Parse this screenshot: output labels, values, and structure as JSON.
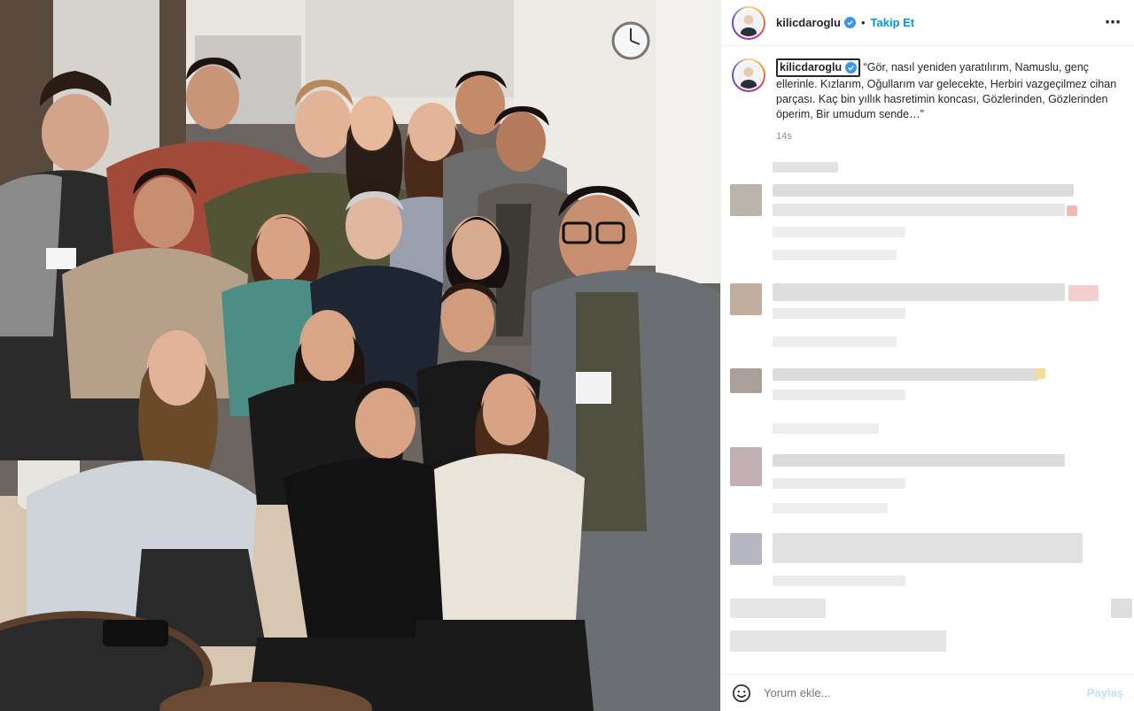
{
  "post": {
    "username": "kilicdaroglu",
    "separator": "•",
    "follow_label": "Takip Et",
    "more_icon": "⋯",
    "caption": "“Gör, nasıl yeniden yaratılırım, Namuslu, genç ellerinle. Kızlarım, Oğullarım var gelecekte, Herbiri vazgeçilmez cihan parçası. Kaç bin yıllık hasretimin koncası, Gözlerinden, Gözlerinden öperim, Bir umudum sende…”",
    "time": "14s"
  },
  "footer": {
    "comment_placeholder": "Yorum ekle...",
    "share_label": "Paylaş"
  },
  "colors": {
    "accent": "#0095f6",
    "verified": "#3897f0"
  },
  "icons": [
    "verified-badge-icon",
    "more-options-icon",
    "emoji-icon"
  ]
}
